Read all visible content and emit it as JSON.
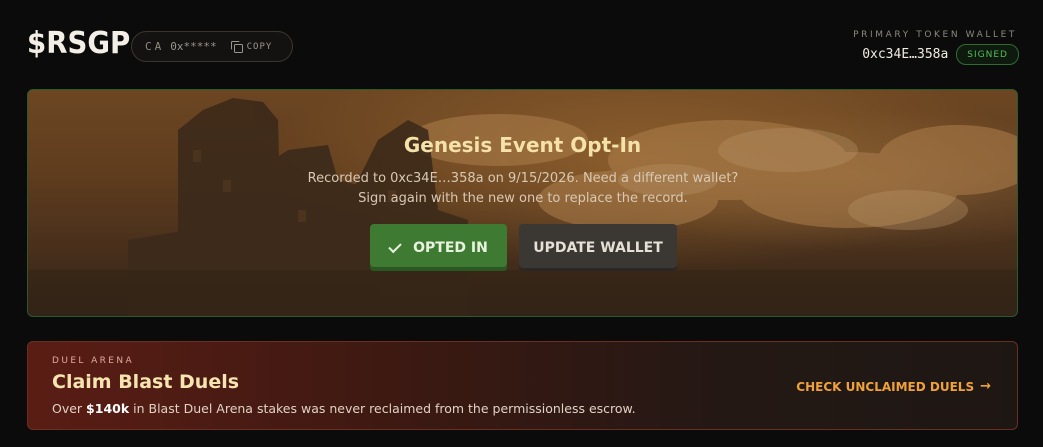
{
  "header": {
    "logo": "$RSGP",
    "ca": {
      "label": "CA",
      "address": "0x*****",
      "copy_label": "COPY",
      "copy_icon": "copy-icon"
    },
    "wallet": {
      "title": "PRIMARY TOKEN WALLET",
      "address": "0xc34E…358a",
      "status": "SIGNED"
    }
  },
  "hero": {
    "title": "Genesis Event Opt-In",
    "description": "Recorded to 0xc34E…358a on 9/15/2026. Need a different wallet? Sign again with the new one to replace the record.",
    "opted_in_label": "OPTED IN",
    "update_label": "UPDATE WALLET"
  },
  "duel": {
    "kicker": "DUEL ARENA",
    "title": "Claim Blast Duels",
    "desc_before": "Over ",
    "desc_amount": "$140k",
    "desc_after": " in Blast Duel Arena stakes was never reclaimed from the permissionless escrow.",
    "link_label": "CHECK UNCLAIMED DUELS",
    "link_arrow": "→"
  },
  "colors": {
    "background": "#0b0b0b",
    "accent_green": "#3f7a32",
    "accent_orange": "#f0a23a",
    "signed_green": "#4fbf55"
  }
}
